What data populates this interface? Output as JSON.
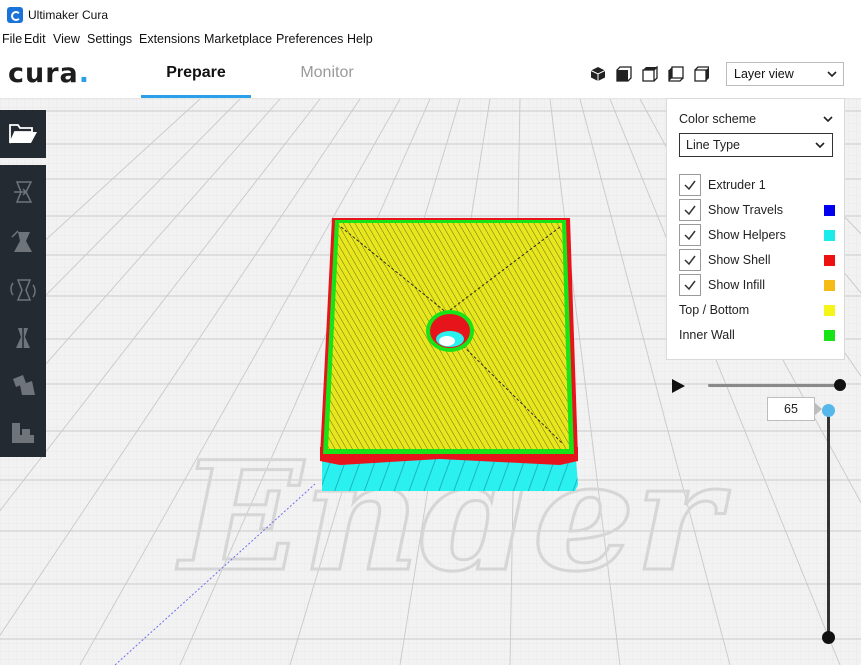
{
  "window": {
    "title": "Ultimaker Cura"
  },
  "menu": [
    "File",
    "Edit",
    "View",
    "Settings",
    "Extensions",
    "Marketplace",
    "Preferences",
    "Help"
  ],
  "header": {
    "logo": "cura",
    "logo_dot": ".",
    "stages": [
      "Prepare",
      "Monitor"
    ],
    "active_stage": "Prepare",
    "view_buttons": [
      "3d-view-icon",
      "front-view-icon",
      "top-view-icon",
      "left-side-view-icon",
      "right-side-view-icon"
    ],
    "view_type": "Layer view"
  },
  "toolbar": {
    "open_icon": "folder-open-icon",
    "tools": [
      "move-tool-icon",
      "scale-tool-icon",
      "rotate-tool-icon",
      "mirror-tool-icon",
      "per-model-settings-icon",
      "support-blocker-icon"
    ]
  },
  "legend": {
    "color_scheme_title": "Color scheme",
    "color_scheme_value": "Line Type",
    "rows": [
      {
        "label": "Extruder 1",
        "checked": true,
        "color": ""
      },
      {
        "label": "Show Travels",
        "checked": true,
        "color": "#0000ee"
      },
      {
        "label": "Show Helpers",
        "checked": true,
        "color": "#19ece9"
      },
      {
        "label": "Show Shell",
        "checked": true,
        "color": "#ee1111"
      },
      {
        "label": "Show Infill",
        "checked": true,
        "color": "#f5bb16"
      }
    ],
    "legend_items": [
      {
        "label": "Top / Bottom",
        "color": "#f5f51b"
      },
      {
        "label": "Inner Wall",
        "color": "#17e317"
      }
    ]
  },
  "layer_slider": {
    "current_layer": "65",
    "play_icon": "play-icon"
  },
  "scene": {
    "build_plate_text": "Ender",
    "colors": {
      "top_bottom": "#e7e61e",
      "shell": "#e8141b",
      "inner_wall": "#16e516",
      "helpers": "#21e9ea",
      "travels": "#1010dd"
    }
  }
}
